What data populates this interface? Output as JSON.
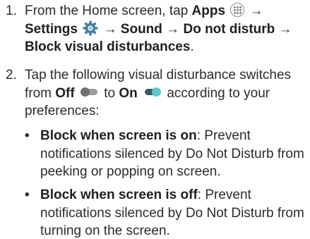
{
  "steps": [
    {
      "number": "1.",
      "lines": {
        "l1_pre": "From the Home screen, tap ",
        "apps": "Apps",
        "arrow1": " → ",
        "settings": "Settings",
        "arrow2": " → ",
        "sound": "Sound",
        "arrow3": " → ",
        "dnd": "Do not disturb",
        "arrow4": " →",
        "block": "Block visual disturbances",
        "period": "."
      }
    },
    {
      "number": "2.",
      "lines": {
        "l1": "Tap the following visual disturbance switches",
        "from": "from ",
        "off": "Off",
        "to": " to ",
        "on": "On",
        "according": " according to your",
        "preferences": "preferences:"
      }
    }
  ],
  "bullets": [
    {
      "symbol": "•",
      "title": "Block when screen is on",
      "colon_text": ": Prevent",
      "line2": "notifications silenced by Do Not Disturb from",
      "line3": "peeking or popping on screen."
    },
    {
      "symbol": "•",
      "title": "Block when screen is off",
      "colon_text": ": Prevent",
      "line2": "notifications silenced by Do Not Disturb from",
      "line3": "turning on the screen."
    }
  ],
  "icons": {
    "apps": "apps-icon",
    "settings": "gear-icon",
    "toggle_off": "toggle-off-icon",
    "toggle_on": "toggle-on-icon"
  },
  "colors": {
    "toggle_on_thumb": "#5ec7c7",
    "toggle_off_thumb": "#6f6f6f",
    "gear": "#4a7fa0"
  }
}
